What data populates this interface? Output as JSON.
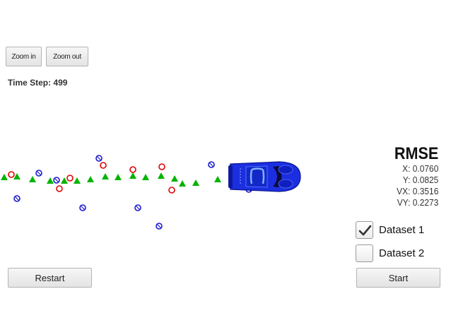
{
  "toolbar": {
    "zoom_in_label": "Zoom in",
    "zoom_out_label": "Zoom out"
  },
  "status": {
    "time_step_label": "Time Step: 499"
  },
  "rmse": {
    "title": "RMSE",
    "x": "X: 0.0760",
    "y": "Y: 0.0825",
    "vx": "VX: 0.3516",
    "vy": "VY: 0.2273"
  },
  "datasets": [
    {
      "label": "Dataset 1",
      "checked": true
    },
    {
      "label": "Dataset 2",
      "checked": false
    }
  ],
  "controls": {
    "restart_label": "Restart",
    "start_label": "Start"
  },
  "colors": {
    "ground_truth": "#00b400",
    "lidar": "#e00000",
    "radar": "#1a1ad0",
    "car_body": "#1c2fe0"
  },
  "legend_icons": [
    "green-triangle-marker",
    "red-circle-marker",
    "blue-circle-marker",
    "blue-car-icon"
  ]
}
